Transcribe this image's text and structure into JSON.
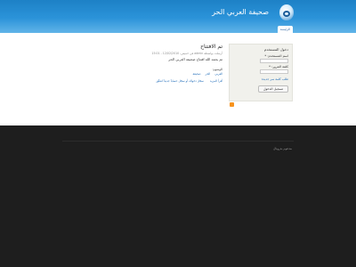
{
  "header": {
    "site_name": "صحيفة العربي الحر",
    "tab_home": "الرئيسة"
  },
  "main": {
    "post_title": "تم الافتتاح",
    "post_meta": "أرسلت بواسطة admin في خميس، 12/02/2010 - 15:01",
    "post_body": "تم بحمد الله افتتاح صحيفة العربي الحر",
    "tags_label": "الوسوم:",
    "tags": [
      "العربي",
      "الحر",
      "صحيفة"
    ],
    "post_links": [
      "أقرأ المزيد",
      "سجّل دخولك أو سجّل حساباً جديداً لتعلّق"
    ]
  },
  "sidebar": {
    "title": "دخول المستخدم",
    "username_label": "اسم المستخدم: *",
    "password_label": "كلمة المرور: *",
    "register_link": "طلب كلمة سر جديدة",
    "login_button": "تسجيل الدخول"
  },
  "footer": {
    "text": "مدعوم بدروبال"
  }
}
